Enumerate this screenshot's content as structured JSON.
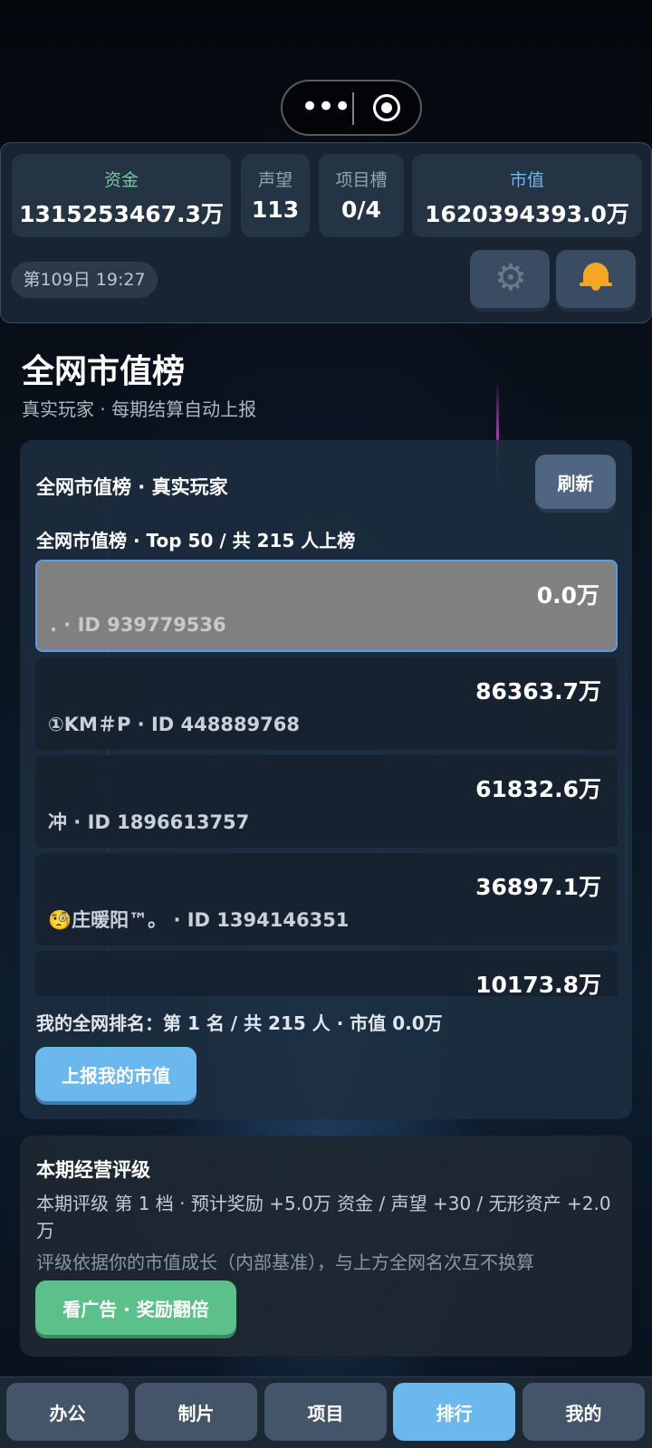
{
  "header": {
    "stats": [
      {
        "label": "资金",
        "value": "1315253467.3万",
        "color": "#6fc79a"
      },
      {
        "label": "声望",
        "value": "113"
      },
      {
        "label": "项目槽",
        "value": "0/4"
      },
      {
        "label": "市值",
        "value": "1620394393.0万",
        "color": "#6ab8ee"
      }
    ],
    "day_time": "第109日 19:27",
    "settings_icon": "gear-icon",
    "notification_icon": "bell-icon"
  },
  "page": {
    "title": "全网市值榜",
    "subtitle": "真实玩家 · 每期结算自动上报"
  },
  "leaderboard": {
    "card_title": "全网市值榜 · 真实玩家",
    "refresh_label": "刷新",
    "summary": "全网市值榜 · Top 50 / 共 215 人上榜",
    "rows": [
      {
        "value": "0.0万",
        "who": ". · ID 939779536",
        "active": true
      },
      {
        "value": "86363.7万",
        "who": "①KM＃P · ID 448889768"
      },
      {
        "value": "61832.6万",
        "who": "冲 · ID 1896613757"
      },
      {
        "value": "36897.1万",
        "who": "🧐庄暖阳™。 · ID 1394146351"
      },
      {
        "value": "10173.8万",
        "who": ""
      }
    ],
    "my_rank": "我的全网排名：第 1 名 / 共 215 人 · 市值 0.0万",
    "report_label": "上报我的市值"
  },
  "rating": {
    "title": "本期经营评级",
    "desc": "本期评级 第 1 档 · 预计奖励 +5.0万 资金 / 声望 +30 / 无形资产 +2.0万",
    "note": "评级依据你的市值成长（内部基准），与上方全网名次互不换算",
    "ad_label": "看广告 · 奖励翻倍"
  },
  "tabs": [
    {
      "label": "办公"
    },
    {
      "label": "制片"
    },
    {
      "label": "项目"
    },
    {
      "label": "排行",
      "active": true
    },
    {
      "label": "我的"
    }
  ]
}
